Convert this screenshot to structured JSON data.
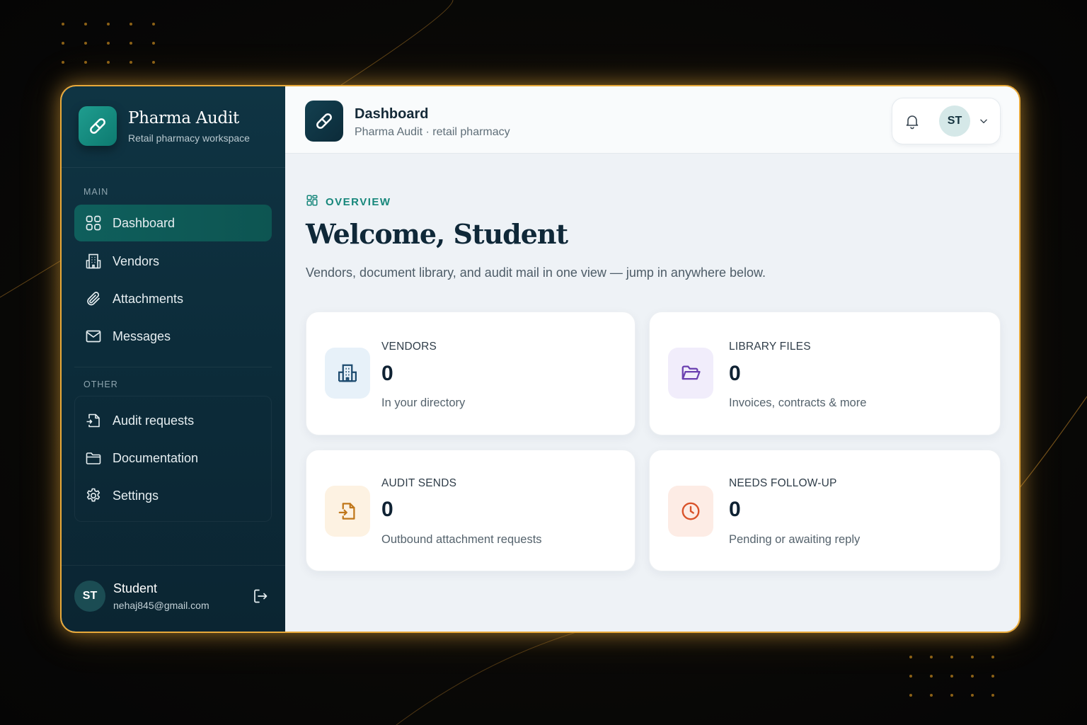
{
  "brand": {
    "title": "Pharma Audit",
    "subtitle": "Retail pharmacy workspace",
    "logo_icon": "pill-icon"
  },
  "sidebar": {
    "sections": [
      {
        "label": "MAIN",
        "items": [
          {
            "label": "Dashboard",
            "icon": "grid-icon",
            "active": true
          },
          {
            "label": "Vendors",
            "icon": "building-icon"
          },
          {
            "label": "Attachments",
            "icon": "paperclip-icon"
          },
          {
            "label": "Messages",
            "icon": "mail-icon"
          }
        ]
      },
      {
        "label": "OTHER",
        "items": [
          {
            "label": "Audit requests",
            "icon": "file-send-icon"
          },
          {
            "label": "Documentation",
            "icon": "folder-icon"
          },
          {
            "label": "Settings",
            "icon": "gear-icon"
          }
        ]
      }
    ],
    "user": {
      "initials": "ST",
      "name": "Student",
      "email": "nehaj845@gmail.com"
    }
  },
  "header": {
    "title": "Dashboard",
    "subtitle": "Pharma Audit · retail pharmacy",
    "avatar_initials": "ST"
  },
  "main": {
    "overview_label": "OVERVIEW",
    "welcome": "Welcome, Student",
    "welcome_sub": "Vendors, document library, and audit mail in one view — jump in anywhere below.",
    "cards": [
      {
        "label": "VENDORS",
        "value": "0",
        "desc": "In your directory",
        "icon": "building-icon",
        "accent": "#1c4a6e"
      },
      {
        "label": "LIBRARY FILES",
        "value": "0",
        "desc": "Invoices, contracts & more",
        "icon": "folder-open-icon",
        "accent": "#6a3fb0"
      },
      {
        "label": "AUDIT SENDS",
        "value": "0",
        "desc": "Outbound attachment requests",
        "icon": "file-send-icon",
        "accent": "#c0771a"
      },
      {
        "label": "NEEDS FOLLOW-UP",
        "value": "0",
        "desc": "Pending or awaiting reply",
        "icon": "clock-icon",
        "accent": "#d9532a"
      }
    ]
  },
  "colors": {
    "sidebar_bg": "#0f3443",
    "active_item": "#0f5f5c",
    "accent_teal": "#17877b",
    "frame_glow": "#e8a93a"
  }
}
